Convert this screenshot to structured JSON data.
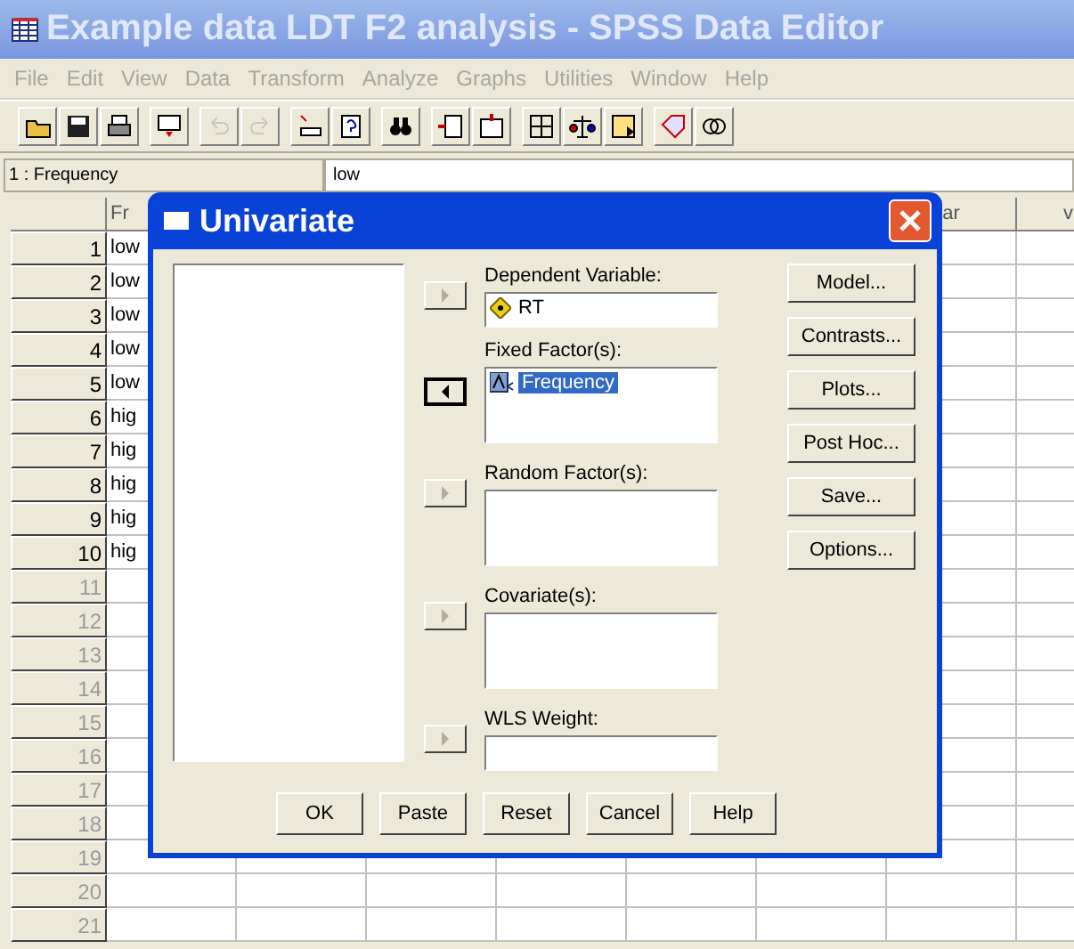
{
  "window": {
    "title": "Example data LDT F2 analysis - SPSS Data Editor",
    "active": false
  },
  "menu": [
    "File",
    "Edit",
    "View",
    "Data",
    "Transform",
    "Analyze",
    "Graphs",
    "Utilities",
    "Window",
    "Help"
  ],
  "toolbar": [
    [
      {
        "kind": "folder",
        "disabled": false
      },
      {
        "kind": "floppy",
        "disabled": false
      },
      {
        "kind": "printer",
        "disabled": false
      }
    ],
    [
      {
        "kind": "monitor",
        "disabled": false
      }
    ],
    [
      {
        "kind": "undo",
        "disabled": true
      },
      {
        "kind": "redo",
        "disabled": true
      }
    ],
    [
      {
        "kind": "goto",
        "disabled": false
      },
      {
        "kind": "variable",
        "disabled": false
      }
    ],
    [
      {
        "kind": "binoculars",
        "disabled": false
      }
    ],
    [
      {
        "kind": "insert-row",
        "disabled": false
      },
      {
        "kind": "insert-column",
        "disabled": false
      }
    ],
    [
      {
        "kind": "split",
        "disabled": false
      },
      {
        "kind": "scale",
        "disabled": false
      },
      {
        "kind": "select",
        "disabled": false
      }
    ],
    [
      {
        "kind": "tag",
        "disabled": false
      },
      {
        "kind": "circles",
        "disabled": false
      }
    ]
  ],
  "cell_ref": {
    "name": "1 : Frequency",
    "value": "low"
  },
  "grid": {
    "columns": [
      {
        "header": "Fr"
      },
      {},
      {},
      {},
      {},
      {},
      {
        "header": "ar"
      },
      {
        "header": "v"
      }
    ],
    "rows": [
      {
        "number": "1",
        "cell": "low"
      },
      {
        "number": "2",
        "cell": "low"
      },
      {
        "number": "3",
        "cell": "low"
      },
      {
        "number": "4",
        "cell": "low"
      },
      {
        "number": "5",
        "cell": "low"
      },
      {
        "number": "6",
        "cell": "hig"
      },
      {
        "number": "7",
        "cell": "hig"
      },
      {
        "number": "8",
        "cell": "hig"
      },
      {
        "number": "9",
        "cell": "hig"
      },
      {
        "number": "10",
        "cell": "hig"
      },
      {
        "number": "11"
      },
      {
        "number": "12"
      },
      {
        "number": "13"
      },
      {
        "number": "14"
      },
      {
        "number": "15"
      },
      {
        "number": "16"
      },
      {
        "number": "17"
      },
      {
        "number": "18"
      },
      {
        "number": "19"
      },
      {
        "number": "20"
      },
      {
        "number": "21"
      }
    ]
  },
  "dialog": {
    "title": "Univariate",
    "targets": [
      {
        "label": "Dependent Variable:",
        "kind": "single",
        "arrow_disabled": true,
        "items": [
          {
            "text": "RT",
            "kind": "scale",
            "selected": false
          }
        ]
      },
      {
        "label": "Fixed Factor(s):",
        "kind": "list",
        "arrow_disabled": false,
        "items": [
          {
            "text": "Frequency",
            "kind": "nominal",
            "selected": true
          }
        ]
      },
      {
        "label": "Random Factor(s):",
        "kind": "list",
        "arrow_disabled": true
      },
      {
        "label": "Covariate(s):",
        "kind": "list",
        "arrow_disabled": true
      },
      {
        "label": "WLS Weight:",
        "kind": "single",
        "arrow_disabled": true
      }
    ],
    "side_buttons": [
      "Model...",
      "Contrasts...",
      "Plots...",
      "Post Hoc...",
      "Save...",
      "Options..."
    ],
    "buttons": [
      "OK",
      "Paste",
      "Reset",
      "Cancel",
      "Help"
    ]
  }
}
